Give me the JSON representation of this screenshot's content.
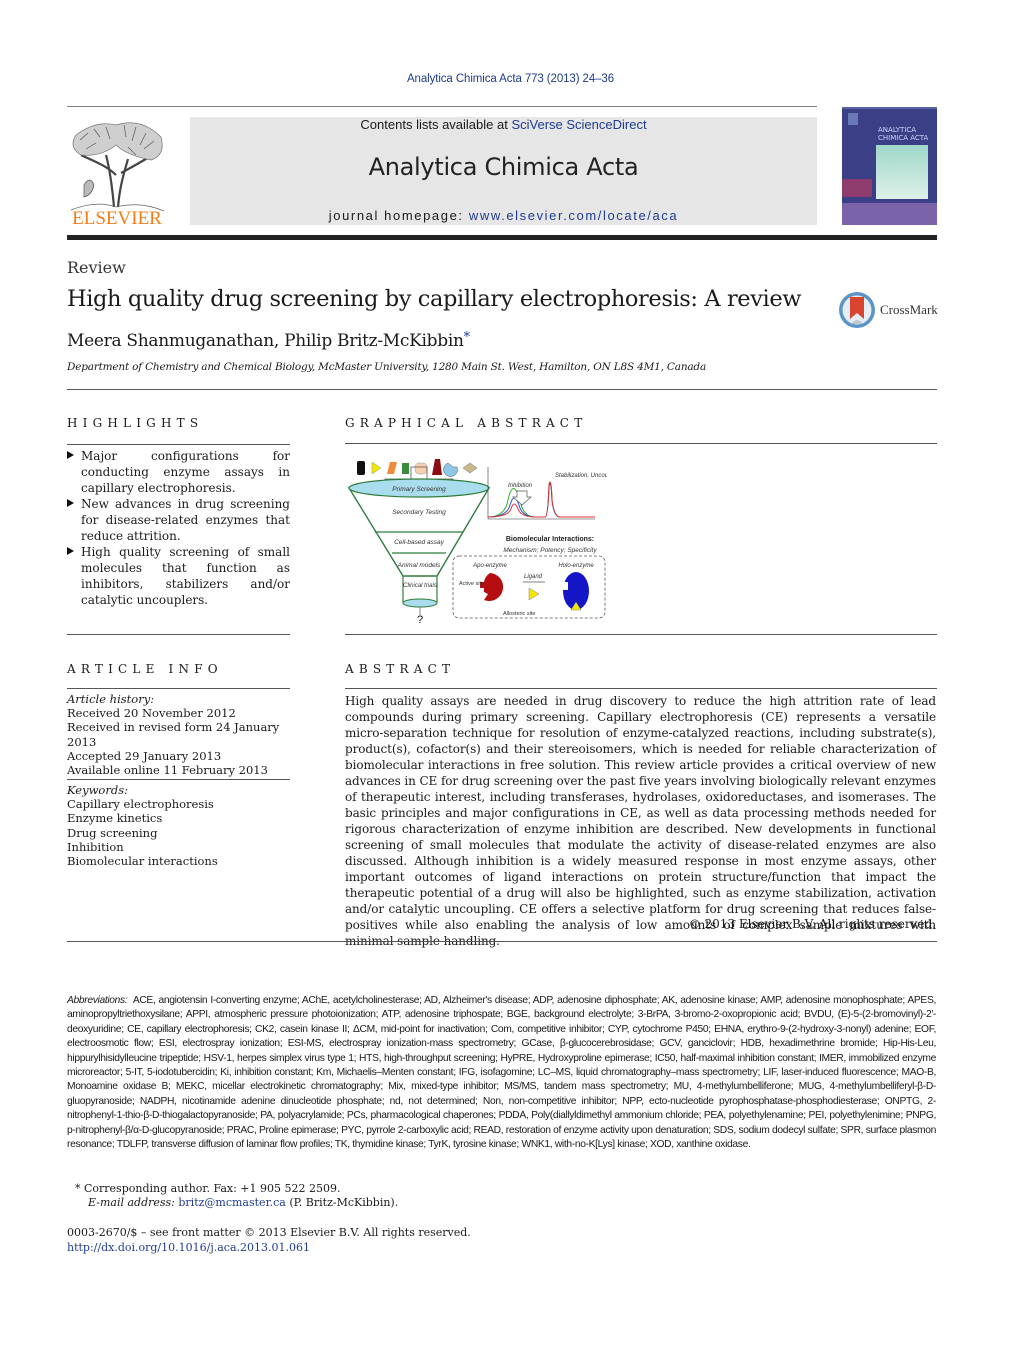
{
  "header": {
    "citation": "Analytica Chimica Acta 773 (2013) 24–36",
    "contents_prefix": "Contents lists available at ",
    "contents_link": "SciVerse ScienceDirect",
    "journal_title": "Analytica Chimica Acta",
    "homepage_prefix": "journal homepage: ",
    "homepage_link": "www.elsevier.com/locate/aca",
    "publisher_logo_text": "ELSEVIER",
    "cover_title_line1": "ANALYTICA",
    "cover_title_line2": "CHIMICA ACTA",
    "colors": {
      "publisher_orange": "#f07d1a",
      "link_blue": "#1f3b8f",
      "banner_gray": "#e6e6e6",
      "cover_navy": "#3a3f86"
    }
  },
  "article": {
    "type": "Review",
    "title": "High quality drug screening by capillary electrophoresis: A review",
    "authors": "Meera Shanmuganathan, Philip Britz-McKibbin",
    "author_mark": "*",
    "affiliation": "Department of Chemistry and Chemical Biology, McMaster University, 1280 Main St. West, Hamilton, ON L8S 4M1, Canada",
    "crossmark_label": "CrossMark"
  },
  "highlights": {
    "heading": "Highlights",
    "items": [
      "Major configurations for conducting enzyme assays in capillary electrophoresis.",
      "New advances in drug screening for disease-related enzymes that reduce attrition.",
      "High quality screening of small molecules that function as inhibitors, stabilizers and/or catalytic uncouplers."
    ]
  },
  "graphical_abstract": {
    "heading": "Graphical abstract",
    "funnel_stages": [
      "Primary Screening",
      "Secondary Testing",
      "Cell-based assay",
      "Animal models",
      "Clinical trials"
    ],
    "funnel_output": "?",
    "electropherogram_labels": [
      "Inhibition",
      "Stabilization, Uncoupling?"
    ],
    "interactions_title": "Biomolecular Interactions:",
    "interactions_subtitle": "Mechanism; Potency; Specificity",
    "apo_label": "Apo-enzyme",
    "holo_label": "Holo-enzyme",
    "ligand_label": "Ligand",
    "active_site_label": "Active site",
    "allosteric_site_label": "Allosteric site"
  },
  "article_info": {
    "heading": "Article info",
    "history_label": "Article history:",
    "history": [
      "Received 20 November 2012",
      "Received in revised form 24 January 2013",
      "Accepted 29 January 2013",
      "Available online 11 February 2013"
    ],
    "keywords_label": "Keywords:",
    "keywords": [
      "Capillary electrophoresis",
      "Enzyme kinetics",
      "Drug screening",
      "Inhibition",
      "Biomolecular interactions"
    ]
  },
  "abstract": {
    "heading": "Abstract",
    "text": "High quality assays are needed in drug discovery to reduce the high attrition rate of lead compounds during primary screening. Capillary electrophoresis (CE) represents a versatile micro-separation technique for resolution of enzyme-catalyzed reactions, including substrate(s), product(s), cofactor(s) and their stereoisomers, which is needed for reliable characterization of biomolecular interactions in free solution. This review article provides a critical overview of new advances in CE for drug screening over the past five years involving biologically relevant enzymes of therapeutic interest, including transferases, hydrolases, oxidoreductases, and isomerases. The basic principles and major configurations in CE, as well as data processing methods needed for rigorous characterization of enzyme inhibition are described. New developments in functional screening of small molecules that modulate the activity of disease-related enzymes are also discussed. Although inhibition is a widely measured response in most enzyme assays, other important outcomes of ligand interactions on protein structure/function that impact the therapeutic potential of a drug will also be highlighted, such as enzyme stabilization, activation and/or catalytic uncoupling. CE offers a selective platform for drug screening that reduces false-positives while also enabling the analysis of low amounts of complex sample mixtures with minimal sample handling.",
    "copyright": "© 2013 Elsevier B.V. All rights reserved."
  },
  "footnotes": {
    "abbreviations_label": "Abbreviations:",
    "abbreviations": "ACE, angiotensin I-converting enzyme; AChE, acetylcholinesterase; AD, Alzheimer's disease; ADP, adenosine diphosphate; AK, adenosine kinase; AMP, adenosine monophosphate; APES, aminopropyltriethoxysilane; APPI, atmospheric pressure photoionization; ATP, adenosine triphospate; BGE, background electrolyte; 3-BrPA, 3-bromo-2-oxopropionic acid; BVDU, (E)-5-(2-bromovinyl)-2′-deoxyuridine; CE, capillary electrophoresis; CK2, casein kinase II; ΔCM, mid-point for inactivation; Com, competitive inhibitor; CYP, cytochrome P450; EHNA, erythro-9-(2-hydroxy-3-nonyl) adenine; EOF, electroosmotic flow; ESI, electrospray ionization; ESI-MS, electrospray ionization-mass spectrometry; GCase, β-glucocerebrosidase; GCV, ganciclovir; HDB, hexadimethrine bromide; Hip-His-Leu, hippurylhisidylleucine tripeptide; HSV-1, herpes simplex virus type 1; HTS, high-throughput screening; HyPRE, Hydroxyproline epimerase; IC50, half-maximal inhibition constant; IMER, immobilized enzyme microreactor; 5-IT, 5-iodotubercidin; Ki, inhibition constant; Km, Michaelis–Menten constant; IFG, isofagomine; LC–MS, liquid chromatography–mass spectrometry; LIF, laser-induced fluorescence; MAO-B, Monoamine oxidase B; MEKC, micellar electrokinetic chromatography; Mix, mixed-type inhibitor; MS/MS, tandem mass spectrometry; MU, 4-methylumbelliferone; MUG, 4-methylumbelliferyl-β-D-gluopyranoside; NADPH, nicotinamide adenine dinucleotide phosphate; nd, not determined; Non, non-competitive inhibitor; NPP, ecto-nucleotide pyrophosphatase-phosphodiesterase; ONPTG, 2-nitrophenyl-1-thio-β-D-thiogalactopyranoside; PA, polyacrylamide; PCs, pharmacological chaperones; PDDA, Poly(diallyldimethyl ammonium chloride; PEA, polyethylenamine; PEI, polyethylenimine; PNPG, p-nitrophenyl-β/α-D-glucopyranoside; PRAC, Proline epimerase; PYC, pyrrole 2-carboxylic acid; READ, restoration of enzyme activity upon denaturation; SDS, sodium dodecyl sulfate; SPR, surface plasmon resonance; TDLFP, transverse diffusion of laminar flow profiles; TK, thymidine kinase; TyrK, tyrosine kinase; WNK1, with-no-K[Lys] kinase; XOD, xanthine oxidase.",
    "corresponding": "*  Corresponding author. Fax: +1 905 522 2509.",
    "email_label": "E-mail address: ",
    "email": "britz@mcmaster.ca",
    "email_suffix": " (P. Britz-McKibbin).",
    "issn": "0003-2670/$ – see front matter © 2013 Elsevier B.V. All rights reserved.",
    "doi": "http://dx.doi.org/10.1016/j.aca.2013.01.061"
  }
}
